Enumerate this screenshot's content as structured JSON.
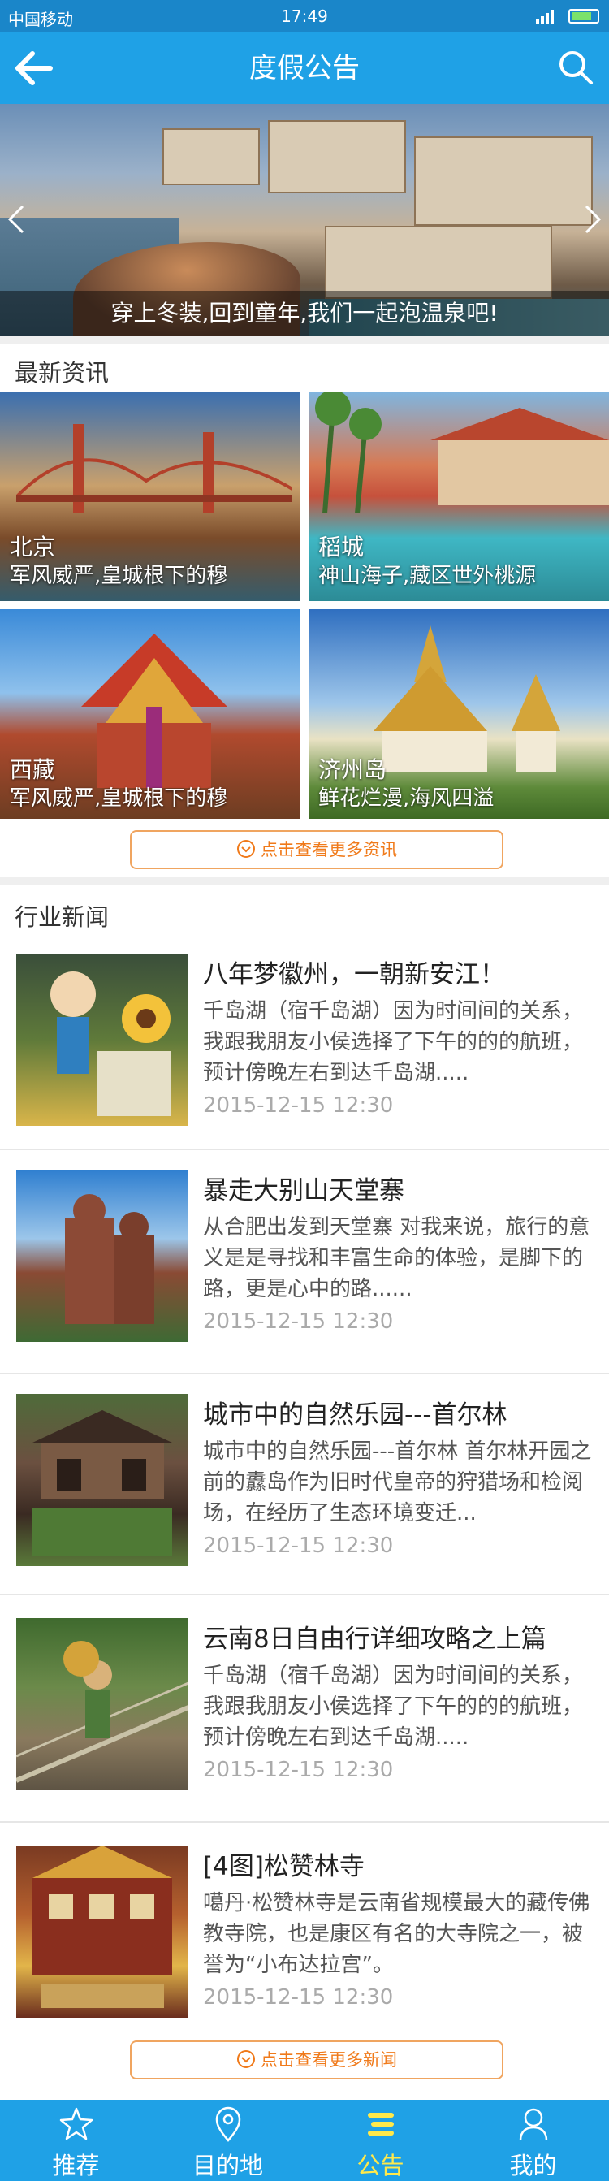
{
  "status_bar": {
    "carrier": "中国移动",
    "time": "17:49"
  },
  "header": {
    "title": "度假公告",
    "back_icon": "arrow-left-icon",
    "search_icon": "search-icon"
  },
  "banner": {
    "caption": "穿上冬装,回到童年,我们一起泡温泉吧!"
  },
  "latest": {
    "title": "最新资讯",
    "items": [
      {
        "name": "北京",
        "desc": "军风威严,皇城根下的穆"
      },
      {
        "name": "稻城",
        "desc": "神山海子,藏区世外桃源"
      },
      {
        "name": "西藏",
        "desc": "军风威严,皇城根下的穆"
      },
      {
        "name": "济州岛",
        "desc": "鲜花烂漫,海风四溢"
      }
    ],
    "more_label": "点击查看更多资讯"
  },
  "industry": {
    "title": "行业新闻",
    "items": [
      {
        "title": "八年梦徽州，一朝新安江！",
        "summary": "千岛湖（宿千岛湖）因为时间间的关系，我跟我朋友小侯选择了下午的的的航班，预计傍晚左右到达千岛湖.....",
        "date": "2015-12-15  12:30"
      },
      {
        "title": "暴走大别山天堂寨",
        "summary": "从合肥出发到天堂寨 对我来说，旅行的意义是是寻找和丰富生命的体验，是脚下的路，更是心中的路......",
        "date": "2015-12-15  12:30"
      },
      {
        "title": "城市中的自然乐园---首尔林",
        "summary": "城市中的自然乐园---首尔林 首尔林开园之前的纛岛作为旧时代皇帝的狩猎场和检阅场，在经历了生态环境变迁...",
        "date": "2015-12-15  12:30"
      },
      {
        "title": "云南8日自由行详细攻略之上篇",
        "summary": "千岛湖（宿千岛湖）因为时间间的关系，我跟我朋友小侯选择了下午的的的航班，预计傍晚左右到达千岛湖.....",
        "date": "2015-12-15  12:30"
      },
      {
        "title": "[4图]松赞林寺",
        "summary": "噶丹·松赞林寺是云南省规模最大的藏传佛教寺院，也是康区有名的大寺院之一，被誉为“小布达拉宫”。",
        "date": "2015-12-15  12:30"
      }
    ],
    "more_label": "点击查看更多新闻"
  },
  "tabs": [
    {
      "label": "推荐",
      "icon": "star-icon"
    },
    {
      "label": "目的地",
      "icon": "location-pin-icon"
    },
    {
      "label": "公告",
      "icon": "announcement-icon"
    },
    {
      "label": "我的",
      "icon": "person-icon"
    }
  ],
  "colors": {
    "primary": "#1fa1e6",
    "accent": "#f07a1a",
    "active_tab": "#ffe94a"
  }
}
